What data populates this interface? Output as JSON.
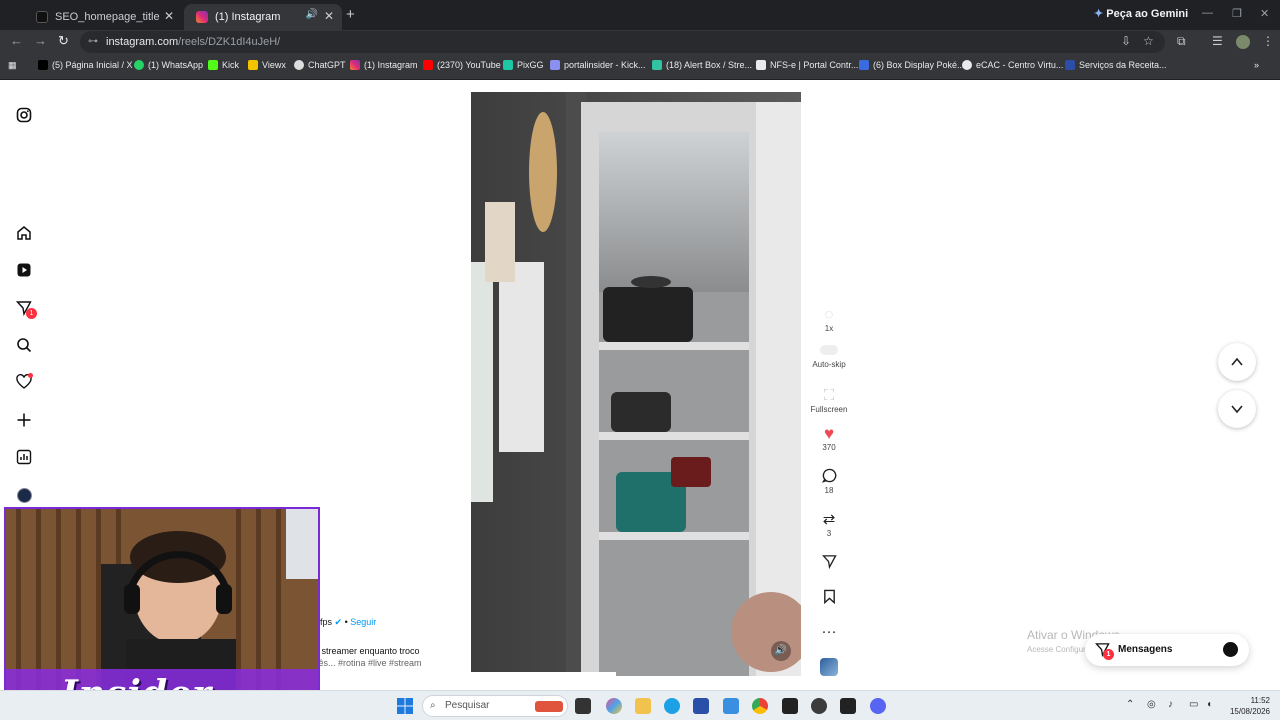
{
  "browser": {
    "tabs": [
      {
        "label": "SEO_homepage_title",
        "active": false
      },
      {
        "label": "(1) Instagram",
        "active": true
      }
    ],
    "gemini_label": "Peça ao Gemini",
    "url_host": "instagram.com",
    "url_path": "/reels/DZK1dI4uJeH/",
    "bookmarks": [
      "(5) Página Inicial / X",
      "(1) WhatsApp",
      "Kick",
      "Viewx",
      "ChatGPT",
      "(1) Instagram",
      "(2370) YouTube",
      "PixGG",
      "portalinsider - Kick...",
      "(18) Alert Box / Stre...",
      "NFS-e | Portal Contr...",
      "(6) Box Display Poké...",
      "eCAC - Centro Virtu...",
      "Serviços da Receita..."
    ]
  },
  "sidebar": {
    "notification_count": "1"
  },
  "reel": {
    "speed_label": "1x",
    "autoskip_label": "Auto-skip",
    "fullscreen_label": "Fullscreen",
    "likes": "370",
    "comments": "18",
    "reposts": "3"
  },
  "caption": {
    "author_fragment": "fps",
    "follow_label": "Seguir",
    "text": "n streamer enquanto troco",
    "tags": "cês... #rotina #live #stream"
  },
  "overlay": {
    "webcam_brand": "Insider"
  },
  "messages": {
    "label": "Mensagens",
    "badge": "1"
  },
  "watermark": {
    "line1": "Ativar o Windows",
    "line2": "Acesse Configurações para ativar o Windows."
  },
  "taskbar": {
    "search_placeholder": "Pesquisar",
    "time": "11:52",
    "date": "15/08/2026"
  },
  "colors": {
    "like_red": "#ed4956",
    "instagram_blue": "#0095f6",
    "webcam_border": "#7a2bd6"
  }
}
